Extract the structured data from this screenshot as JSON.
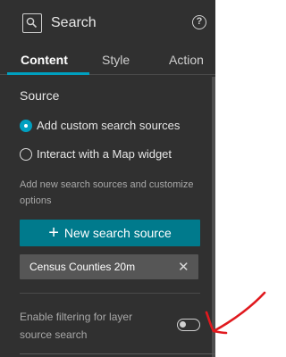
{
  "header": {
    "title": "Search",
    "app_icon": "search-widget-icon",
    "help_icon": "help-icon",
    "help_glyph": "?"
  },
  "tabs": [
    {
      "label": "Content",
      "active": true
    },
    {
      "label": "Style",
      "active": false
    },
    {
      "label": "Action",
      "active": false
    }
  ],
  "source": {
    "title": "Source",
    "options": [
      {
        "label": "Add custom search sources",
        "checked": true
      },
      {
        "label": "Interact with a Map widget",
        "checked": false
      }
    ],
    "helper": "Add new search sources and customize options",
    "new_button": {
      "icon": "+",
      "label": "New search source"
    },
    "sources": [
      {
        "label": "Census Counties 20m",
        "remove_icon": "✕"
      }
    ]
  },
  "filtering": {
    "label": "Enable filtering for layer source search",
    "enabled": false
  },
  "colors": {
    "panel": "#303030",
    "accent": "#00a0c0",
    "button": "#007a8c",
    "annotation": "#e0191e"
  }
}
